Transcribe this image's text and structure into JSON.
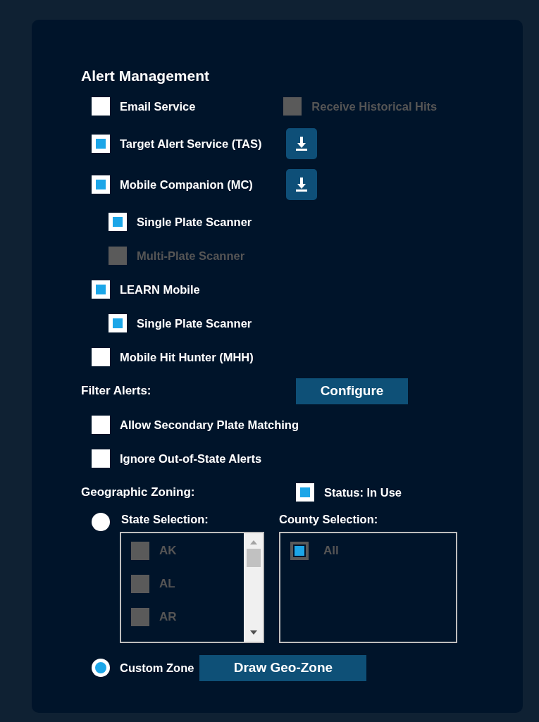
{
  "title": "Alert Management",
  "services": [
    {
      "label": "Email Service",
      "checked": false,
      "disabled": false,
      "download": false,
      "extra": {
        "label": "Receive Historical Hits",
        "checked": false,
        "disabled": true
      }
    },
    {
      "label": "Target Alert Service (TAS)",
      "checked": true,
      "disabled": false,
      "download": true
    },
    {
      "label": "Mobile Companion (MC)",
      "checked": true,
      "disabled": false,
      "download": true,
      "children": [
        {
          "label": "Single Plate Scanner",
          "checked": true,
          "disabled": false
        },
        {
          "label": "Multi-Plate Scanner",
          "checked": false,
          "disabled": true
        }
      ]
    },
    {
      "label": "LEARN Mobile",
      "checked": true,
      "disabled": false,
      "download": false,
      "children": [
        {
          "label": "Single Plate Scanner",
          "checked": true,
          "disabled": false
        }
      ]
    },
    {
      "label": "Mobile Hit Hunter (MHH)",
      "checked": false,
      "disabled": false,
      "download": false
    }
  ],
  "filter": {
    "label": "Filter Alerts:",
    "button": "Configure",
    "options": [
      {
        "label": "Allow Secondary Plate Matching",
        "checked": false
      },
      {
        "label": "Ignore Out-of-State Alerts",
        "checked": false
      }
    ]
  },
  "geo": {
    "label": "Geographic Zoning:",
    "status": {
      "label": "Status: In Use",
      "checked": true
    },
    "state_selection": {
      "label": "State Selection:",
      "selected": false,
      "items": [
        {
          "label": "AK",
          "checked": false
        },
        {
          "label": "AL",
          "checked": false
        },
        {
          "label": "AR",
          "checked": false
        }
      ]
    },
    "county_selection": {
      "label": "County Selection:",
      "items": [
        {
          "label": "All",
          "checked": true
        }
      ]
    },
    "custom_zone": {
      "label": "Custom Zone",
      "selected": true,
      "button": "Draw Geo-Zone"
    }
  }
}
